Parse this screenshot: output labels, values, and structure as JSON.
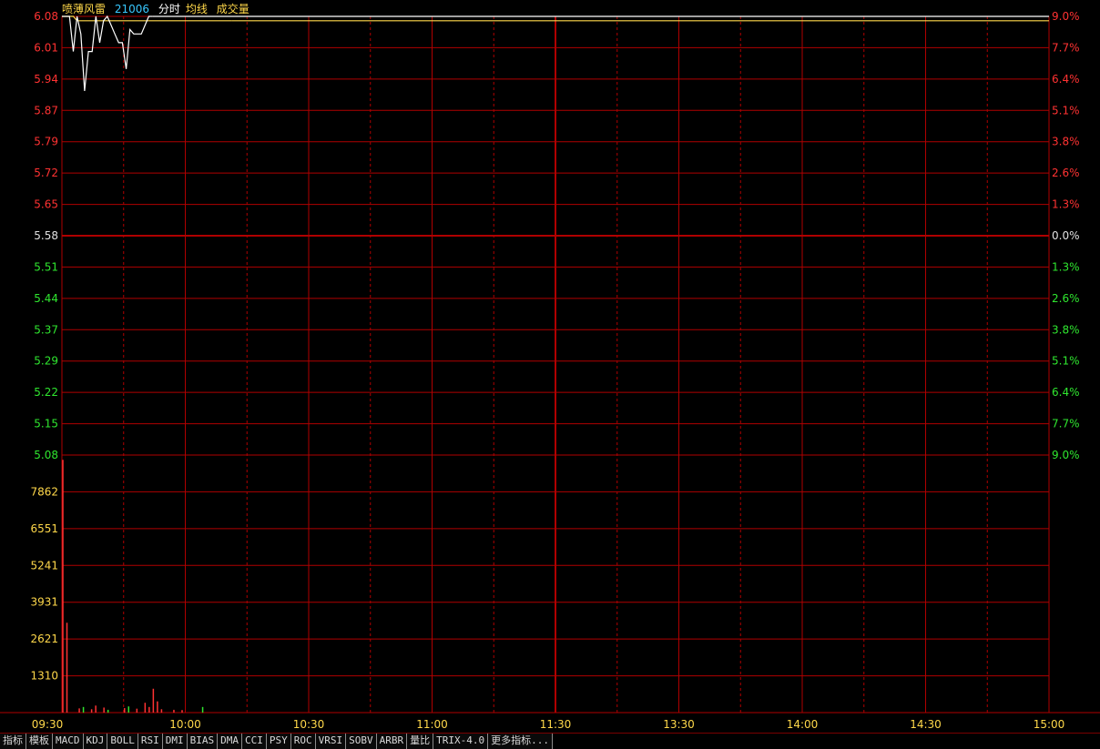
{
  "header": {
    "name": "喷薄风雷",
    "code": "21006",
    "fenshi": "分时",
    "avg_label": "均线",
    "vol_label": "成交量"
  },
  "colors": {
    "bg": "#000000",
    "grid": "#b00000",
    "up": "#ff3232",
    "down": "#2fe62f",
    "neutral": "#e0e0e0",
    "price_line": "#ffffff",
    "avg_line": "#ffd84a",
    "volume_label": "#ffd84a",
    "time_label": "#ffd84a"
  },
  "tabs": [
    "指标",
    "模板",
    "MACD",
    "KDJ",
    "BOLL",
    "RSI",
    "DMI",
    "BIAS",
    "DMA",
    "CCI",
    "PSY",
    "ROC",
    "VRSI",
    "SOBV",
    "ARBR",
    "量比",
    "TRIX-4.0",
    "更多指标..."
  ],
  "chart_data": {
    "type": "line",
    "price_axis": {
      "ticks": [
        "6.08",
        "6.01",
        "5.94",
        "5.87",
        "5.79",
        "5.72",
        "5.65",
        "5.58",
        "5.51",
        "5.44",
        "5.37",
        "5.29",
        "5.22",
        "5.15",
        "5.08"
      ],
      "ylim": [
        5.08,
        6.08
      ],
      "base": 5.58
    },
    "pct_axis": {
      "ticks": [
        "9.0%",
        "7.7%",
        "6.4%",
        "5.1%",
        "3.8%",
        "2.6%",
        "1.3%",
        "0.0%",
        "1.3%",
        "2.6%",
        "3.8%",
        "5.1%",
        "6.4%",
        "7.7%",
        "9.0%"
      ]
    },
    "volume_axis": {
      "ticks": [
        "7862",
        "6551",
        "5241",
        "3931",
        "2621",
        "1310"
      ],
      "ylim": [
        0,
        9172
      ]
    },
    "time_axis": {
      "labels": [
        "09:30",
        "10:00",
        "10:30",
        "11:00",
        "11:30",
        "13:30",
        "14:00",
        "14:30",
        "15:00"
      ],
      "total_minutes": 240
    },
    "series": [
      {
        "x": [
          0,
          1,
          2,
          3,
          4,
          5,
          6,
          7,
          8,
          9,
          10,
          11,
          12,
          13,
          14,
          15,
          16,
          17,
          18,
          19,
          20,
          21,
          22,
          23,
          24,
          25,
          26,
          27,
          28,
          29,
          30,
          31,
          32,
          33,
          34,
          35,
          36,
          37,
          38,
          39,
          40,
          41,
          42,
          43,
          44,
          45
        ],
        "values": [
          6.08,
          6.08,
          6.08,
          6.08,
          6.07,
          6.07,
          6.07,
          6.07,
          6.07,
          6.07,
          6.07,
          6.07,
          6.07,
          6.07,
          6.07,
          6.07,
          6.07,
          6.07,
          6.07,
          6.07,
          6.07,
          6.07,
          6.07,
          6.07,
          6.07,
          6.07,
          6.07,
          6.07,
          6.07,
          6.07,
          6.07,
          6.07,
          6.07,
          6.07,
          6.07,
          6.07,
          6.07,
          6.07,
          6.07,
          6.07,
          6.07,
          6.07,
          6.07,
          6.07,
          6.07,
          6.07
        ]
      },
      {
        "x": [
          0,
          1,
          2,
          3,
          4,
          5,
          6,
          7,
          8,
          9,
          10,
          11,
          12,
          13,
          14,
          15,
          16,
          17,
          18,
          19,
          20,
          21,
          22,
          23,
          24
        ],
        "values": [
          6.08,
          6.08,
          6.08,
          6.0,
          6.08,
          6.04,
          5.91,
          6.0,
          6.0,
          6.08,
          6.02,
          6.07,
          6.08,
          6.06,
          6.04,
          6.02,
          6.02,
          5.96,
          6.05,
          6.04,
          6.04,
          6.04,
          6.06,
          6.08,
          6.08
        ]
      }
    ],
    "volume": [
      {
        "x": 0,
        "v": 9000,
        "c": "up"
      },
      {
        "x": 1,
        "v": 3200,
        "c": "up"
      },
      {
        "x": 4,
        "v": 150,
        "c": "up"
      },
      {
        "x": 5,
        "v": 200,
        "c": "down"
      },
      {
        "x": 7,
        "v": 120,
        "c": "up"
      },
      {
        "x": 8,
        "v": 250,
        "c": "up"
      },
      {
        "x": 10,
        "v": 180,
        "c": "up"
      },
      {
        "x": 11,
        "v": 100,
        "c": "down"
      },
      {
        "x": 15,
        "v": 160,
        "c": "up"
      },
      {
        "x": 16,
        "v": 220,
        "c": "down"
      },
      {
        "x": 18,
        "v": 140,
        "c": "up"
      },
      {
        "x": 20,
        "v": 350,
        "c": "up"
      },
      {
        "x": 21,
        "v": 200,
        "c": "up"
      },
      {
        "x": 22,
        "v": 850,
        "c": "up"
      },
      {
        "x": 23,
        "v": 400,
        "c": "up"
      },
      {
        "x": 24,
        "v": 120,
        "c": "up"
      },
      {
        "x": 27,
        "v": 100,
        "c": "up"
      },
      {
        "x": 29,
        "v": 90,
        "c": "up"
      },
      {
        "x": 34,
        "v": 200,
        "c": "down"
      }
    ]
  }
}
